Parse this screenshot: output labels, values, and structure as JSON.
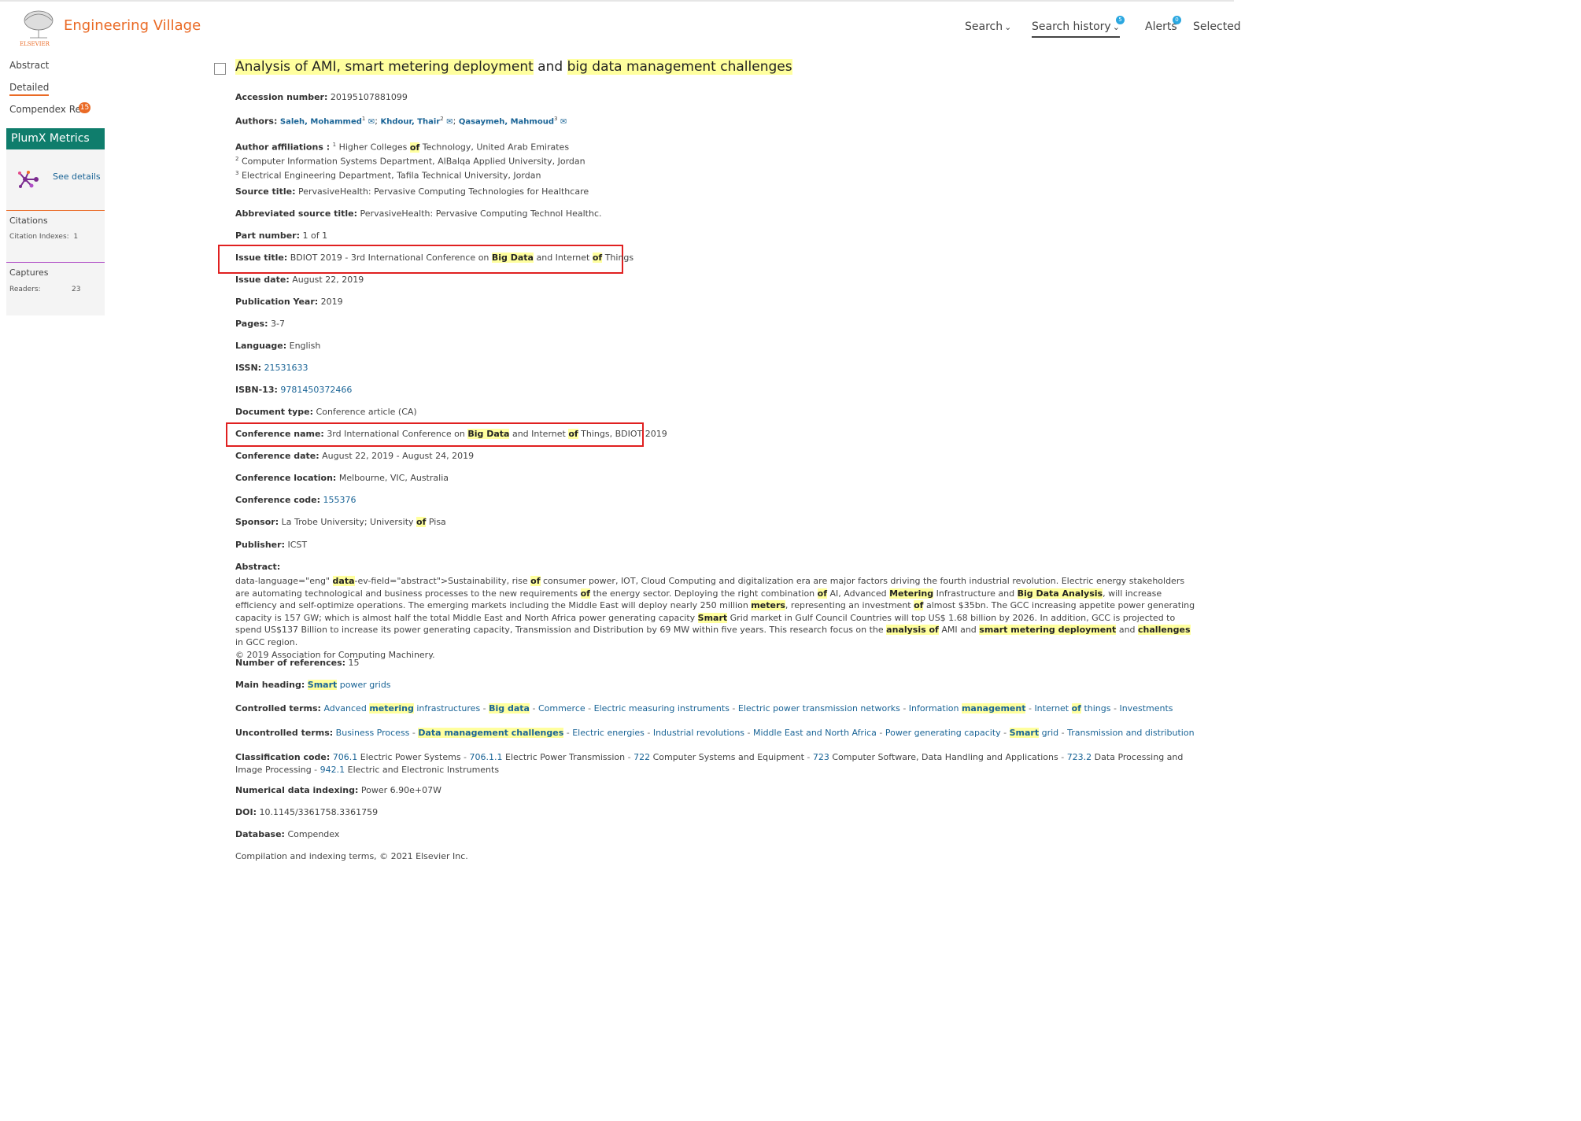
{
  "header": {
    "brand": "Engineering Village",
    "publisher_logo_text": "ELSEVIER",
    "nav": {
      "search": "Search",
      "search_history": "Search history",
      "search_history_count": "5",
      "alerts": "Alerts",
      "alerts_count": "0",
      "selected": "Selected"
    }
  },
  "left_nav": {
    "abstract": "Abstract",
    "detailed": "Detailed",
    "compendex_refs": "Compendex Refs",
    "compendex_refs_count": "15"
  },
  "plumx": {
    "title": "PlumX Metrics",
    "see_details": "See details",
    "citations_heading": "Citations",
    "citation_indexes_label": "Citation Indexes:",
    "citation_indexes_value": "1",
    "captures_heading": "Captures",
    "readers_label": "Readers:",
    "readers_value": "23"
  },
  "record": {
    "title_parts": [
      "Analysis of AMI, smart metering deployment",
      " and ",
      "big data management challenges"
    ],
    "accession_label": "Accession number:",
    "accession_value": "20195107881099",
    "authors_label": "Authors:",
    "authors": [
      {
        "name": "Saleh, Mohammed",
        "sup": "1"
      },
      {
        "name": "Khdour, Thair",
        "sup": "2"
      },
      {
        "name": "Qasaymeh, Mahmoud",
        "sup": "3"
      }
    ],
    "affiliations_label": "Author affiliations :",
    "affiliations": [
      {
        "sup": "1",
        "pre": "Higher Colleges ",
        "hl": "of",
        "post": " Technology, United Arab Emirates"
      },
      {
        "sup": "2",
        "text": "Computer Information Systems Department, AlBalqa Applied University, Jordan"
      },
      {
        "sup": "3",
        "text": "Electrical Engineering Department, Tafila Technical University, Jordan"
      }
    ],
    "source_title_label": "Source title:",
    "source_title": "PervasiveHealth: Pervasive Computing Technologies for Healthcare",
    "abbrev_label": "Abbreviated source title:",
    "abbrev": "PervasiveHealth: Pervasive Computing Technol Healthc.",
    "part_label": "Part number:",
    "part": "1 of 1",
    "issue_title_label": "Issue title:",
    "issue_title_parts": [
      "BDIOT 2019 - 3rd International Conference on ",
      "Big Data",
      " and Internet ",
      "of",
      " Things"
    ],
    "issue_date_label": "Issue date:",
    "issue_date": "August 22, 2019",
    "pub_year_label": "Publication Year:",
    "pub_year": "2019",
    "pages_label": "Pages:",
    "pages": "3-7",
    "language_label": "Language:",
    "language": "English",
    "issn_label": "ISSN:",
    "issn": "21531633",
    "isbn_label": "ISBN-13:",
    "isbn": "9781450372466",
    "doctype_label": "Document type:",
    "doctype": "Conference article (CA)",
    "conf_name_label": "Conference name:",
    "conf_name_parts": [
      "3rd International Conference on ",
      "Big Data",
      " and Internet ",
      "of",
      " Things, BDIOT 2019"
    ],
    "conf_date_label": "Conference date:",
    "conf_date": "August 22, 2019 - August 24, 2019",
    "conf_loc_label": "Conference location:",
    "conf_loc": "Melbourne, VIC, Australia",
    "conf_code_label": "Conference code:",
    "conf_code": "155376",
    "sponsor_label": "Sponsor:",
    "sponsor_parts": [
      "La Trobe University; University ",
      "of",
      " Pisa"
    ],
    "publisher_label": "Publisher:",
    "publisher": "ICST",
    "abstract_label": "Abstract:",
    "abstract_parts": [
      {
        "t": "data-language=\"eng\" "
      },
      {
        "h": "data"
      },
      {
        "t": "-ev-field=\"abstract\">Sustainability, rise "
      },
      {
        "h": "of"
      },
      {
        "t": " consumer power, IOT, Cloud Computing and digitalization era are major factors driving the fourth industrial revolution. Electric energy stakeholders are automating technological and business processes to the new requirements "
      },
      {
        "h": "of"
      },
      {
        "t": " the energy sector. Deploying the right combination "
      },
      {
        "h": "of"
      },
      {
        "t": " AI, Advanced "
      },
      {
        "h": "Metering"
      },
      {
        "t": " Infrastructure and "
      },
      {
        "h": "Big Data Analysis"
      },
      {
        "t": ", will increase efficiency and self-optimize operations. The emerging markets including the Middle East will deploy nearly 250 million "
      },
      {
        "h": "meters"
      },
      {
        "t": ", representing an investment "
      },
      {
        "h": "of"
      },
      {
        "t": " almost $35bn. The GCC increasing appetite power generating capacity is 157 GW; which is almost half the total Middle East and North Africa power generating capacity "
      },
      {
        "h": "Smart"
      },
      {
        "t": " Grid market in Gulf Council Countries will top US$ 1.68 billion by 2026. In addition, GCC is projected to spend US$137 Billion to increase its power generating capacity, Transmission and Distribution by 69 MW within five years. This research focus on the "
      },
      {
        "h": "analysis of"
      },
      {
        "t": " AMI and "
      },
      {
        "h": "smart metering deployment"
      },
      {
        "t": " and "
      },
      {
        "h": "challenges"
      },
      {
        "t": " in GCC region."
      }
    ],
    "copyright": "© 2019 Association for Computing Machinery.",
    "num_refs_label": "Number of references:",
    "num_refs": "15",
    "main_heading_label": "Main heading:",
    "main_heading_parts": [
      "Smart",
      " power grids"
    ],
    "controlled_label": "Controlled terms:",
    "controlled_terms": [
      {
        "p": "Advanced ",
        "h": "metering",
        "s": " infrastructures"
      },
      {
        "h": "Big data"
      },
      {
        "p": "Commerce"
      },
      {
        "p": "Electric measuring instruments"
      },
      {
        "p": "Electric power transmission networks"
      },
      {
        "p": "Information ",
        "h": "management"
      },
      {
        "p": "Internet ",
        "h": "of",
        "s": " things"
      },
      {
        "p": "Investments"
      }
    ],
    "uncontrolled_label": "Uncontrolled terms:",
    "uncontrolled_terms": [
      {
        "p": "Business Process"
      },
      {
        "h": "Data management challenges"
      },
      {
        "p": "Electric energies"
      },
      {
        "p": "Industrial revolutions"
      },
      {
        "p": "Middle East and North Africa"
      },
      {
        "p": "Power generating capacity"
      },
      {
        "h": "Smart",
        "s": " grid"
      },
      {
        "p": "Transmission and distribution"
      }
    ],
    "classification_label": "Classification code:",
    "classification": [
      {
        "code": "706.1",
        "desc": "Electric Power Systems"
      },
      {
        "code": "706.1.1",
        "desc": "Electric Power Transmission"
      },
      {
        "code": "722",
        "desc": "Computer Systems and Equipment"
      },
      {
        "code": "723",
        "desc": "Computer Software, Data Handling and Applications"
      },
      {
        "code": "723.2",
        "desc": "Data Processing and Image Processing"
      },
      {
        "code": "942.1",
        "desc": "Electric and Electronic Instruments"
      }
    ],
    "numerical_label": "Numerical data indexing:",
    "numerical": "Power 6.90e+07W",
    "doi_label": "DOI:",
    "doi": "10.1145/3361758.3361759",
    "database_label": "Database:",
    "database": "Compendex",
    "compilation": "Compilation and indexing terms, © 2021 Elsevier Inc."
  }
}
